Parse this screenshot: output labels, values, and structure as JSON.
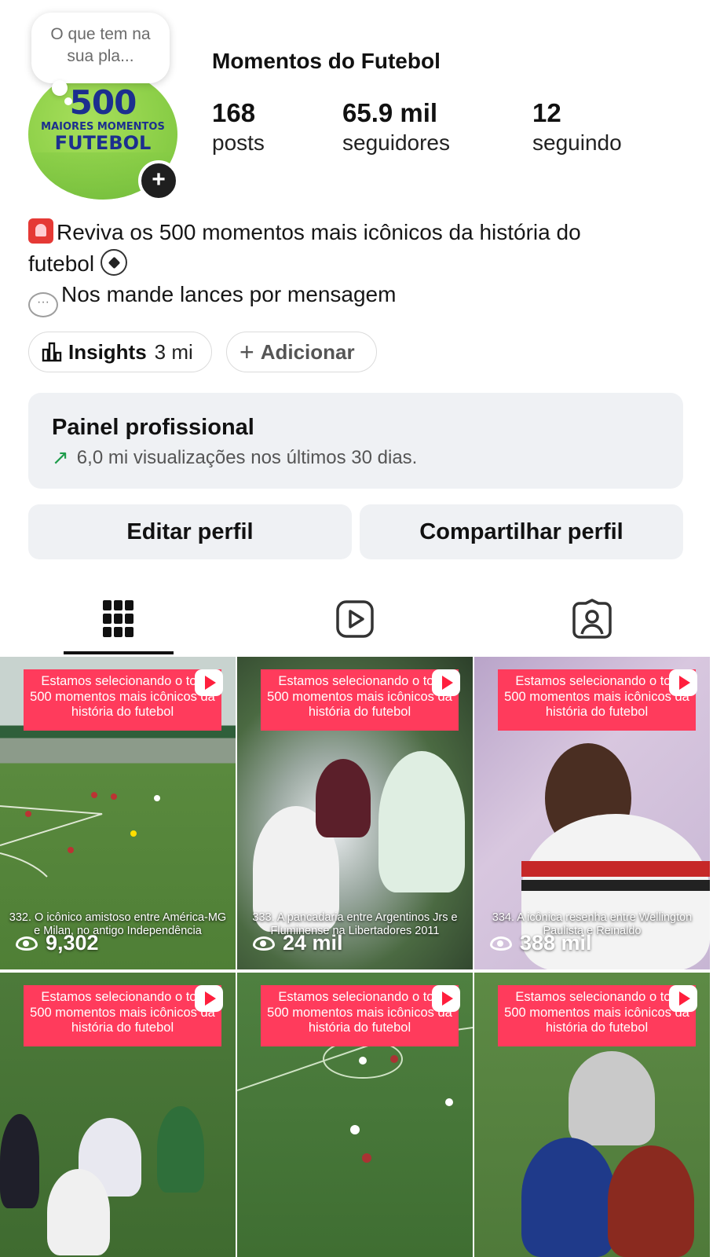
{
  "profile": {
    "name": "Momentos do Futebol",
    "note": "O que tem na sua pla...",
    "avatar_logo": {
      "number": "500",
      "line1": "MAIORES MOMENTOS",
      "line2": "FUTEBOL"
    },
    "add_story": "+"
  },
  "stats": [
    {
      "value": "168",
      "label": "posts"
    },
    {
      "value": "65.9 mil",
      "label": "seguidores"
    },
    {
      "value": "12",
      "label": "seguindo"
    }
  ],
  "bio": {
    "line1": "Reviva os 500 momentos mais icônicos da história do",
    "line2": "futebol",
    "line3": "Nos mande lances por mensagem"
  },
  "chips": {
    "insights_label": "Insights",
    "insights_value": "3 mi",
    "add_label": "Adicionar"
  },
  "dashboard": {
    "title": "Painel profissional",
    "subtitle": "6,0 mi visualizações nos últimos 30 dias."
  },
  "buttons": {
    "edit": "Editar perfil",
    "share": "Compartilhar perfil"
  },
  "tabs": [
    {
      "icon": "grid-icon",
      "active": true
    },
    {
      "icon": "reels-icon",
      "active": false
    },
    {
      "icon": "tagged-icon",
      "active": false
    }
  ],
  "posts": [
    {
      "banner": "Estamos selecionando o top 500 momentos mais icônicos da história do futebol",
      "caption": "332. O icônico amistoso entre América-MG e Milan, no antigo Independência",
      "views": "9,302"
    },
    {
      "banner": "Estamos selecionando o top 500 momentos mais icônicos da história do futebol",
      "caption": "333. A pancadaria entre Argentinos Jrs e Fluminense na Libertadores 2011",
      "views": "24 mil"
    },
    {
      "banner": "Estamos selecionando o top 500 momentos mais icônicos da história do futebol",
      "caption": "334. A icônica resenha entre Wellington Paulista e Reinaldo",
      "views": "388 mil"
    },
    {
      "banner": "Estamos selecionando o top 500 momentos mais icônicos da história do futebol",
      "caption": "",
      "views": ""
    },
    {
      "banner": "Estamos selecionando o top 500 momentos mais icônicos da história do futebol",
      "caption": "",
      "views": ""
    },
    {
      "banner": "Estamos selecionando o top 500 momentos mais icônicos da história do futebol",
      "caption": "",
      "views": ""
    }
  ],
  "colors": {
    "banner": "#ff3b5c",
    "accent_green": "#1e9c4b",
    "button_bg": "#eff1f4"
  }
}
